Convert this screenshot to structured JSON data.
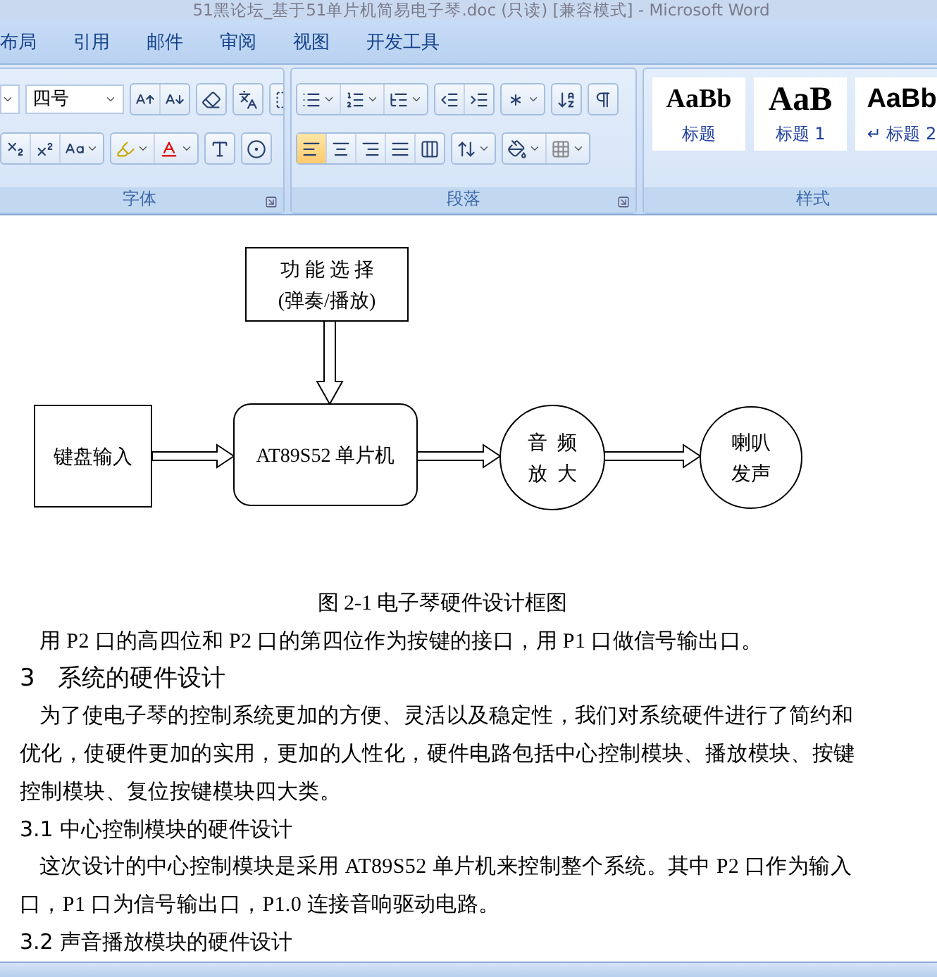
{
  "window": {
    "title": "51黑论坛_基于51单片机简易电子琴.doc (只读) [兼容模式] - Microsoft Word"
  },
  "ribbon_tabs": [
    "布局",
    "引用",
    "邮件",
    "审阅",
    "视图",
    "开发工具"
  ],
  "font_group": {
    "label": "字体",
    "font_size": "四号"
  },
  "paragraph_group": {
    "label": "段落",
    "alignments": [
      {
        "kind": "left",
        "selected": true
      },
      {
        "kind": "center",
        "selected": false
      },
      {
        "kind": "right",
        "selected": false
      },
      {
        "kind": "justify",
        "selected": false
      },
      {
        "kind": "distributed",
        "selected": false
      }
    ]
  },
  "styles_group": {
    "label": "样式",
    "styles": [
      {
        "preview": "AaBb",
        "name": "标题",
        "kind": "serif"
      },
      {
        "preview": "AaB",
        "name": "标题 1",
        "kind": "serif-large"
      },
      {
        "preview": "AaBb",
        "name": "标题 2",
        "kind": "sans",
        "prefix": "↵"
      }
    ]
  },
  "diagram": {
    "nodes": [
      {
        "kind": "rect",
        "lines": [
          "功 能 选 择",
          "(弹奏/播放)"
        ]
      },
      {
        "kind": "rect",
        "lines": [
          "键盘输入"
        ]
      },
      {
        "kind": "rounded",
        "lines": [
          "AT89S52 单片机"
        ]
      },
      {
        "kind": "circle",
        "lines": [
          "音  频",
          "放  大"
        ]
      },
      {
        "kind": "circle",
        "lines": [
          "喇叭",
          "发声"
        ]
      }
    ]
  },
  "document": {
    "blocks": [
      {
        "kind": "caption",
        "text": "图 2-1 电子琴硬件设计框图"
      },
      {
        "kind": "para",
        "text": "用 P2 口的高四位和 P2 口的第四位作为按键的接口，用 P1 口做信号输出口。"
      },
      {
        "kind": "h1",
        "text": "3   系统的硬件设计"
      },
      {
        "kind": "para",
        "text": "为了使电子琴的控制系统更加的方便、灵活以及稳定性，我们对系统硬件进行了简约和优化，使硬件更加的实用，更加的人性化，硬件电路包括中心控制模块、播放模块、按键控制模块、复位按键模块四大类。"
      },
      {
        "kind": "h2",
        "text": "3.1 中心控制模块的硬件设计"
      },
      {
        "kind": "para",
        "text": "这次设计的中心控制模块是采用 AT89S52 单片机来控制整个系统。其中 P2 口作为输入口，P1 口为信号输出口，P1.0 连接音响驱动电路。"
      },
      {
        "kind": "h2",
        "text": "3.2 声音播放模块的硬件设计"
      }
    ]
  }
}
